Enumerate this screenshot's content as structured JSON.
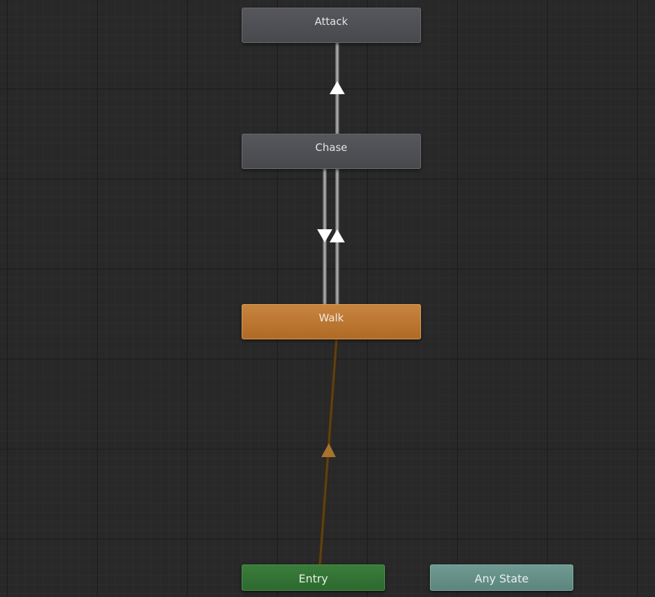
{
  "states": {
    "attack": {
      "label": "Attack",
      "color": "#4f5055"
    },
    "chase": {
      "label": "Chase",
      "color": "#4f5055"
    },
    "walk": {
      "label": "Walk",
      "color": "#bd7830"
    },
    "entry": {
      "label": "Entry",
      "color": "#327333"
    },
    "any_state": {
      "label": "Any State",
      "color": "#658f87"
    }
  },
  "transitions": [
    {
      "from": "Chase",
      "to": "Attack",
      "color": "#9a9a9a"
    },
    {
      "from": "Chase",
      "to": "Walk",
      "color": "#9a9a9a"
    },
    {
      "from": "Walk",
      "to": "Chase",
      "color": "#9a9a9a"
    },
    {
      "from": "Entry",
      "to": "Walk",
      "color": "#5a3d14"
    }
  ],
  "colors": {
    "canvas_background": "#282828",
    "grid_line": "#1b1b1b",
    "transition_arrow": "#ffffff",
    "entry_arrow": "#a8742c"
  }
}
